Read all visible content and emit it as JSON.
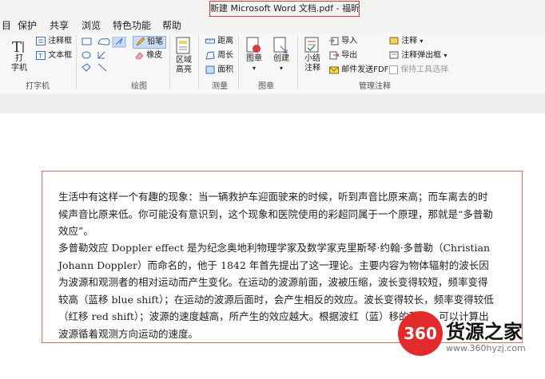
{
  "window": {
    "title": "新建 Microsoft Word 文档.pdf - 福昕阅读器"
  },
  "menu": [
    "目",
    "保护",
    "共享",
    "浏览",
    "特色功能",
    "帮助"
  ],
  "ribbon": {
    "typewriter": {
      "big_label": "打\n字机",
      "comment_box": "注释框",
      "text_box": "文本框",
      "group": "打字机"
    },
    "drawing": {
      "pencil": "铅笔",
      "eraser": "橡皮",
      "group": "绘图"
    },
    "area": {
      "label": "区域\n高亮"
    },
    "measure": {
      "distance": "距离",
      "perimeter": "周长",
      "area": "面积",
      "group": "测量"
    },
    "stamp": {
      "stamp_label": "图章",
      "create_label": "创建",
      "group": "图章"
    },
    "annotation": {
      "summary_label": "小结\n注释",
      "import": "导入",
      "export": "导出",
      "email_fdf": "邮件发送FDF",
      "comment": "注释",
      "comment_popup": "注释弹出框",
      "keep_tool": "保持工具选择",
      "group": "管理注释"
    }
  },
  "document": {
    "paragraphs": [
      "生活中有这样一个有趣的现象：当一辆救护车迎面驶来的时候，听到声音比原来高；而车离去的时候声音比原来低。你可能没有意识到，这个现象和医院使用的彩超同属于一个原理，那就是“多普勒效应”。",
      "多普勒效应 Doppler effect 是为纪念奥地利物理学家及数学家克里斯琴·约翰·多普勒（Christian Johann Doppler）而命名的，他于 1842 年首先提出了这一理论。主要内容为物体辐射的波长因为波源和观测者的相对运动而产生变化。在运动的波源前面，波被压缩，波长变得较短，频率变得较高（蓝移 blue shift）；在运动的波源后面时，会产生相反的效应。波长变得较长，频率变得较低（红移 red shift）；波源的速度越高，所产生的效应越大。根据波红（蓝）移的程度，可以计算出波源循着观测方向运动的速度。"
    ]
  },
  "watermark": {
    "badge": "360",
    "name": "货源之家",
    "url": "www.360hyzj.com"
  },
  "colors": {
    "highlight_red": "#d93a3a",
    "frame_red": "#e06a6a",
    "ribbon_bg": "#f7f7f7"
  }
}
